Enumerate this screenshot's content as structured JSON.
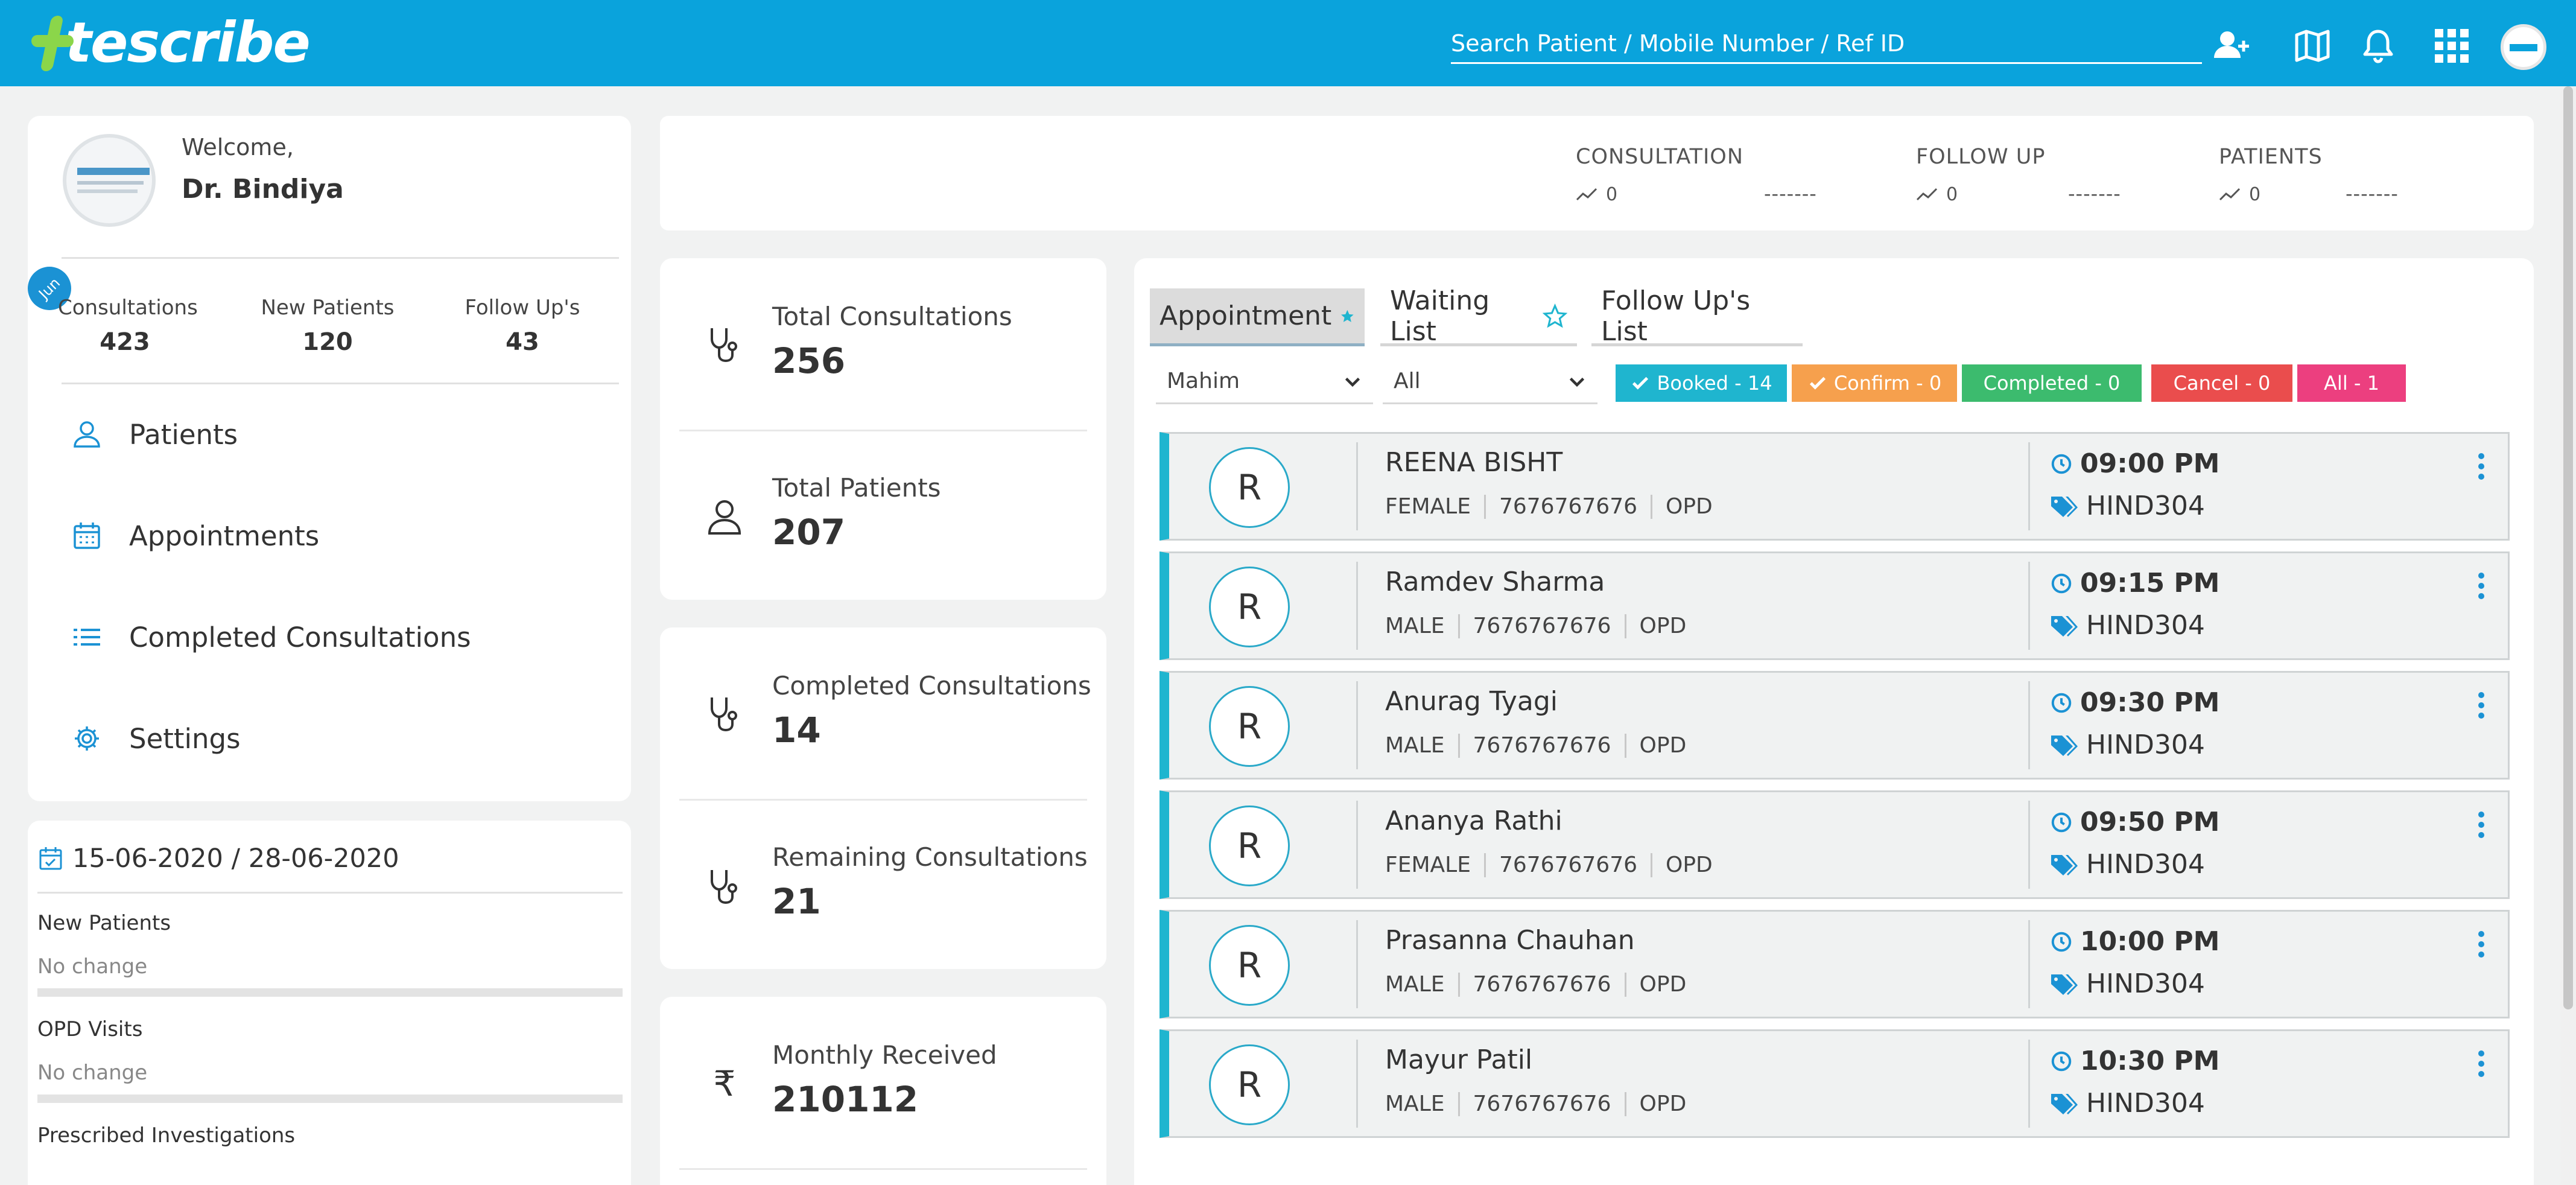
{
  "header": {
    "logo_text": "tescribe",
    "search_placeholder": "Search Patient / Mobile Number / Ref ID",
    "icons": [
      "add-user-icon",
      "map-icon",
      "bell-icon",
      "apps-grid-icon",
      "user-avatar"
    ]
  },
  "profile": {
    "welcome": "Welcome,",
    "name": "Dr. Bindiya",
    "badge": "Jun",
    "stats": [
      {
        "label": "Consultations",
        "value": "423"
      },
      {
        "label": "New Patients",
        "value": "120"
      },
      {
        "label": "Follow Up's",
        "value": "43"
      }
    ],
    "menu": [
      {
        "label": "Patients",
        "icon": "user-icon"
      },
      {
        "label": "Appointments",
        "icon": "calendar-icon"
      },
      {
        "label": "Completed Consultations",
        "icon": "list-icon"
      },
      {
        "label": "Settings",
        "icon": "gear-icon"
      }
    ]
  },
  "date_panel": {
    "range": "15-06-2020 / 28-06-2020",
    "metrics": [
      {
        "label": "New Patients",
        "sub": "No change"
      },
      {
        "label": "OPD Visits",
        "sub": "No change"
      },
      {
        "label": "Prescribed Investigations"
      }
    ]
  },
  "top_stats": [
    {
      "label": "CONSULTATION",
      "value": "0",
      "dash": "-------"
    },
    {
      "label": "FOLLOW UP",
      "value": "0",
      "dash": "-------"
    },
    {
      "label": "PATIENTS",
      "value": "0",
      "dash": "-------"
    }
  ],
  "summary": [
    {
      "label": "Total Consultations",
      "value": "256",
      "icon": "stethoscope-icon"
    },
    {
      "label": "Total Patients",
      "value": "207",
      "icon": "user-icon"
    },
    {
      "label": "Completed Consultations",
      "value": "14",
      "icon": "stethoscope-icon"
    },
    {
      "label": "Remaining Consultations",
      "value": "21",
      "icon": "stethoscope-icon"
    },
    {
      "label": "Monthly Received",
      "value": "210112",
      "icon": "rupee-icon",
      "symbol": "₹"
    }
  ],
  "appointments_panel": {
    "tabs": [
      "Appointment",
      "Waiting List",
      "Follow Up's List"
    ],
    "filters": {
      "location": "Mahim",
      "type": "All"
    },
    "status_pills": [
      {
        "label": "Booked - 14",
        "color": "#1fb5cf"
      },
      {
        "label": "Confirm - 0",
        "color": "#f6a04d"
      },
      {
        "label": "Completed - 0",
        "color": "#3cbb6e"
      },
      {
        "label": "Cancel - 0",
        "color": "#ea4d4d"
      },
      {
        "label": "All - 1",
        "color": "#ec3f7f"
      }
    ],
    "rows": [
      {
        "initial": "R",
        "name": "REENA BISHT",
        "gender": "FEMALE",
        "phone": "7676767676",
        "dept": "OPD",
        "time": "09:00 PM",
        "ref": "HIND304"
      },
      {
        "initial": "R",
        "name": "Ramdev Sharma",
        "gender": "MALE",
        "phone": "7676767676",
        "dept": "OPD",
        "time": "09:15 PM",
        "ref": "HIND304"
      },
      {
        "initial": "R",
        "name": "Anurag Tyagi",
        "gender": "MALE",
        "phone": "7676767676",
        "dept": "OPD",
        "time": "09:30 PM",
        "ref": "HIND304"
      },
      {
        "initial": "R",
        "name": "Ananya Rathi",
        "gender": "FEMALE",
        "phone": "7676767676",
        "dept": "OPD",
        "time": "09:50 PM",
        "ref": "HIND304"
      },
      {
        "initial": "R",
        "name": "Prasanna Chauhan",
        "gender": "MALE",
        "phone": "7676767676",
        "dept": "OPD",
        "time": "10:00 PM",
        "ref": "HIND304"
      },
      {
        "initial": "R",
        "name": "Mayur Patil",
        "gender": "MALE",
        "phone": "7676767676",
        "dept": "OPD",
        "time": "10:30 PM",
        "ref": "HIND304"
      }
    ]
  },
  "colors": {
    "topbar": "#0aa3dc",
    "accent": "#1fb5cf",
    "logo_plus": "#8bd64a"
  }
}
